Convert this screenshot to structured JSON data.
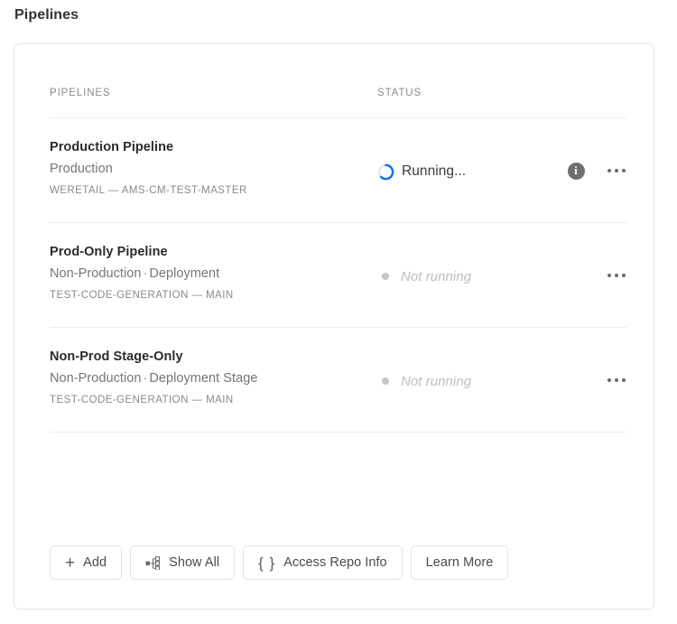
{
  "page": {
    "title": "Pipelines"
  },
  "table": {
    "headers": {
      "pipelines": "PIPELINES",
      "status": "STATUS"
    },
    "rows": [
      {
        "name": "Production Pipeline",
        "environment": "Production",
        "separator": "·",
        "stage": "",
        "repo": "WERETAIL — AMS-CM-TEST-MASTER",
        "status": {
          "label": "Running...",
          "state": "running",
          "icon": "spinner-icon",
          "accent_color": "#1473e6"
        },
        "has_info": true,
        "info_icon": "info-icon",
        "menu_icon": "more-options-icon"
      },
      {
        "name": "Prod-Only Pipeline",
        "environment": "Non-Production",
        "separator": "·",
        "stage": "Deployment",
        "repo": "TEST-CODE-GENERATION — MAIN",
        "status": {
          "label": "Not running",
          "state": "idle",
          "icon": "status-dot-icon",
          "accent_color": "#c6c6c6"
        },
        "has_info": false,
        "info_icon": "",
        "menu_icon": "more-options-icon"
      },
      {
        "name": "Non-Prod Stage-Only",
        "environment": "Non-Production",
        "separator": "·",
        "stage": "Deployment Stage",
        "repo": "TEST-CODE-GENERATION — MAIN",
        "status": {
          "label": "Not running",
          "state": "idle",
          "icon": "status-dot-icon",
          "accent_color": "#c6c6c6"
        },
        "has_info": false,
        "info_icon": "",
        "menu_icon": "more-options-icon"
      }
    ]
  },
  "footer": {
    "buttons": [
      {
        "label": "Add",
        "icon": "plus-icon"
      },
      {
        "label": "Show All",
        "icon": "hierarchy-icon"
      },
      {
        "label": "Access Repo Info",
        "icon": "curly-braces-icon"
      },
      {
        "label": "Learn More",
        "icon": ""
      }
    ]
  }
}
